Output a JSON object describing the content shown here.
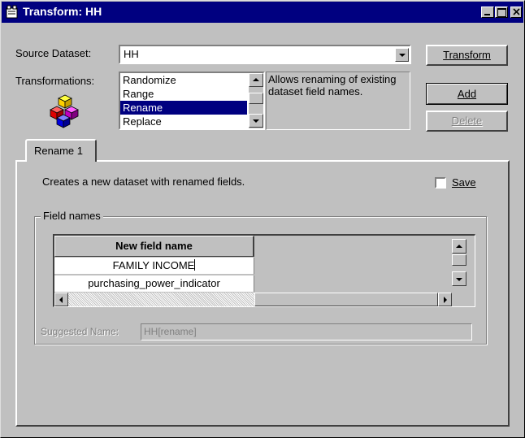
{
  "window": {
    "title": "Transform: HH"
  },
  "source_dataset": {
    "label": "Source Dataset:",
    "value": "HH"
  },
  "transformations": {
    "label": "Transformations:",
    "items": [
      "Randomize",
      "Range",
      "Rename",
      "Replace"
    ],
    "selected": "Rename",
    "description": "Allows renaming of existing dataset field names."
  },
  "buttons": {
    "transform": "Transform",
    "add": "Add",
    "delete": "Delete"
  },
  "tab": {
    "label": "Rename 1"
  },
  "panel": {
    "description": "Creates a new dataset with renamed fields.",
    "save_label": "Save",
    "save_checked": false
  },
  "field_names": {
    "legend": "Field names",
    "column_header": "New field name",
    "rows": [
      "FAMILY INCOME",
      "purchasing_power_indicator"
    ]
  },
  "suggested_name": {
    "label": "Suggested Name:",
    "value": "HH[rename]"
  },
  "colors": {
    "titlebar": "#000080",
    "face": "#c0c0c0",
    "selection": "#000080"
  }
}
